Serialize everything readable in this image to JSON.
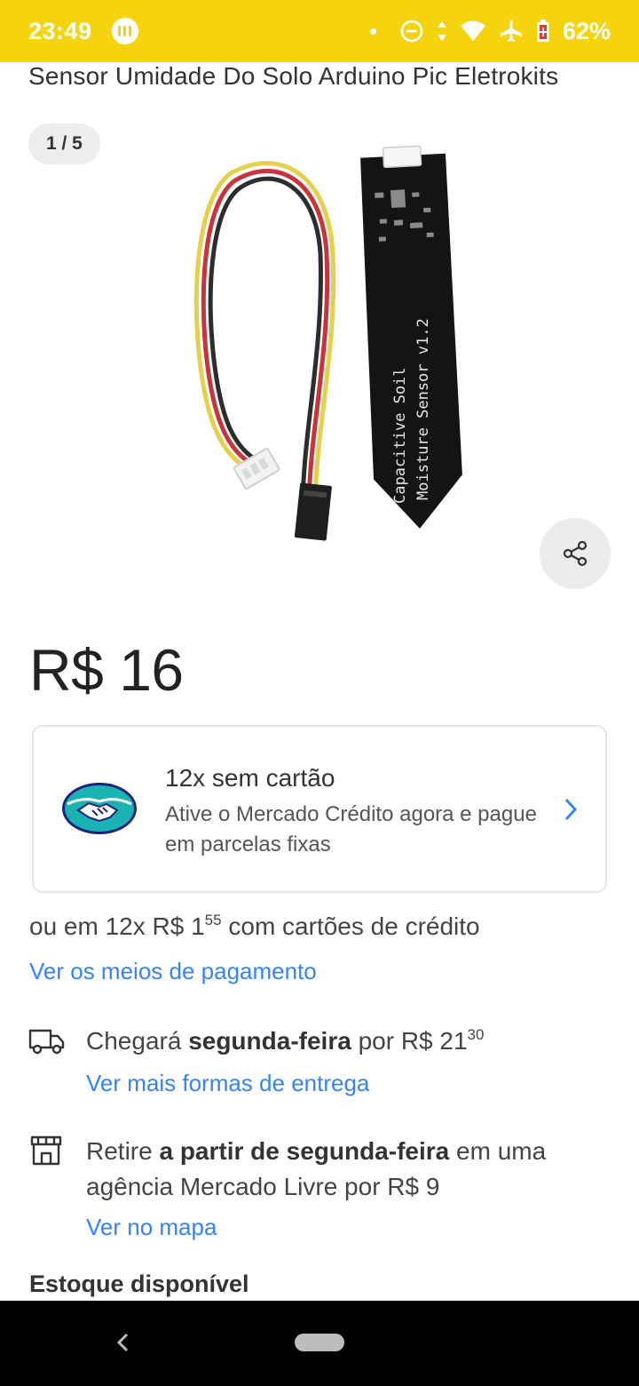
{
  "status_bar": {
    "time": "23:49",
    "battery": "62%",
    "icons": [
      "app-indicator-icon",
      "dnd-icon",
      "data-arrows-icon",
      "wifi-icon",
      "airplane-icon",
      "battery-icon"
    ]
  },
  "product": {
    "title": "Sensor Umidade Do Solo Arduino Pic Eletrokits",
    "gallery_counter": "1 / 5",
    "image_text_line1": "Capacitive  Soil",
    "image_text_line2": "Moisture Sensor v1.2",
    "price": "R$ 16"
  },
  "credit_offer": {
    "title": "12x sem cartão",
    "description": "Ative o Mercado Crédito agora e pague em parcelas fixas"
  },
  "installments": {
    "prefix": "ou em 12x R$ 1",
    "cents": "55",
    "suffix": " com cartões de crédito",
    "link": "Ver os meios de pagamento"
  },
  "delivery": {
    "prefix": "Chegará ",
    "day": "segunda-feira",
    "middle": " por R$ 21",
    "cents": "30",
    "link": "Ver mais formas de entrega"
  },
  "pickup": {
    "prefix": "Retire ",
    "bold": "a partir de segunda-feira",
    "suffix": " em uma agência Mercado Livre por R$ 9",
    "link": "Ver no mapa"
  },
  "stock": {
    "heading": "Estoque disponível"
  },
  "colors": {
    "brand_yellow": "#f5d40f",
    "link_blue": "#3483fa"
  }
}
